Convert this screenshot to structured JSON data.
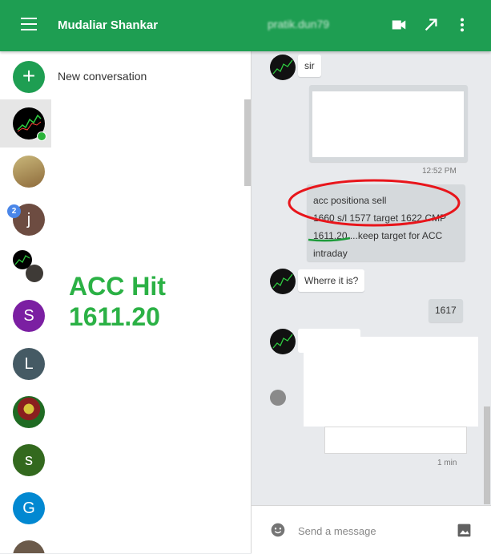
{
  "header": {
    "app_name": "Mudaliar Shankar",
    "chat_title": "pratik.dun79",
    "icons": [
      "menu-icon",
      "video-call-icon",
      "expand-icon",
      "more-vert-icon"
    ],
    "brand_color": "#1e9e52"
  },
  "sidebar": {
    "new_conversation_label": "New conversation",
    "conversations": [
      {
        "avatar_type": "image",
        "selected": true,
        "online": true
      },
      {
        "avatar_type": "image"
      },
      {
        "avatar_type": "letter",
        "letter": "j",
        "color": "#6d4c41",
        "badge": "2"
      },
      {
        "avatar_type": "group-image"
      },
      {
        "avatar_type": "letter",
        "letter": "S",
        "color": "#7b1fa2"
      },
      {
        "avatar_type": "letter",
        "letter": "L",
        "color": "#455a64"
      },
      {
        "avatar_type": "image"
      },
      {
        "avatar_type": "letter",
        "letter": "s",
        "color": "#33691e"
      },
      {
        "avatar_type": "letter",
        "letter": "G",
        "color": "#0288d1"
      },
      {
        "avatar_type": "image"
      }
    ],
    "overlay_line1": "ACC Hit",
    "overlay_line2": "1611.20"
  },
  "messages": {
    "msg1": "sir",
    "time1": "12:52 PM",
    "msg3_line1": "acc positiona sell",
    "msg3_line2": "1660 s/l 1577 target 1622 CMP",
    "msg3_line3_a": "1611.20",
    "msg3_line3_b": " ...keep target for ACC",
    "msg3_line4": "intraday",
    "msg4": "Wherre it is?",
    "msg5": "1617",
    "time_last": "1 min"
  },
  "compose": {
    "placeholder": "Send a message",
    "icons": [
      "emoji-icon",
      "image-icon"
    ]
  }
}
